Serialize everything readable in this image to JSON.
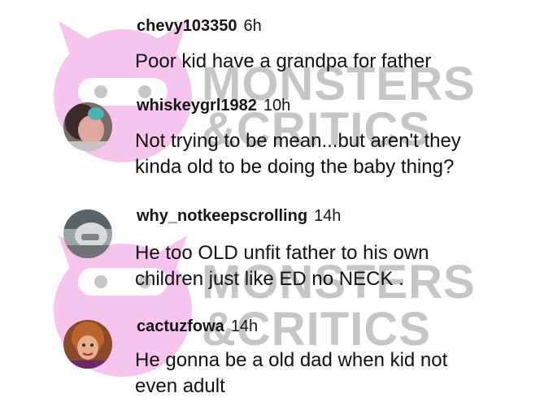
{
  "watermark": {
    "brand_lines": [
      "MONSTERS",
      "&CRITICS"
    ],
    "icon": "monster-mascot-icon",
    "mascot_color": "#f6c4ec",
    "text_color": "#c6c6c6"
  },
  "comments": [
    {
      "username": "chevy103350",
      "time": "6h",
      "lines": [
        "Poor kid have a grandpa for father"
      ],
      "avatar_icon": "avatar-default-icon"
    },
    {
      "username": "whiskeygrl1982",
      "time": "10h",
      "lines": [
        "Not trying to be mean...but aren't they",
        "kinda old to be doing the baby thing?"
      ],
      "avatar_icon": "avatar-photo-icon"
    },
    {
      "username": "why_notkeepscrolling",
      "time": "14h",
      "lines": [
        "He too OLD unfit father to his own",
        "children just like ED no NECK ."
      ],
      "avatar_icon": "avatar-photo-icon"
    },
    {
      "username": "cactuzfowa",
      "time": "14h",
      "lines": [
        "He gonna be a old dad when kid not",
        "even adult"
      ],
      "avatar_icon": "avatar-photo-icon"
    }
  ]
}
